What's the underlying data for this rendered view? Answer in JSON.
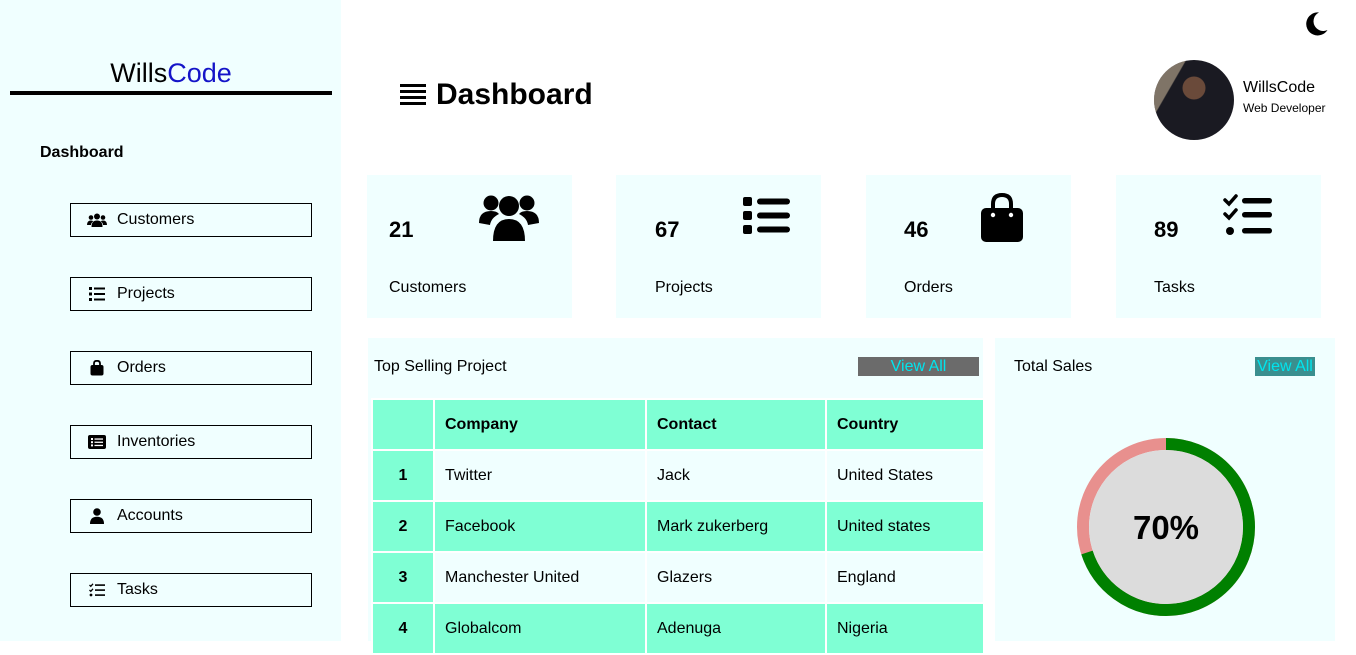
{
  "sidebar": {
    "brand_part1": "Wills",
    "brand_part2": "Code",
    "section_title": "Dashboard",
    "items": [
      {
        "label": "Customers",
        "icon": "users-icon"
      },
      {
        "label": "Projects",
        "icon": "list-icon"
      },
      {
        "label": "Orders",
        "icon": "shopping-bag-icon"
      },
      {
        "label": "Inventories",
        "icon": "list-alt-icon"
      },
      {
        "label": "Accounts",
        "icon": "user-icon"
      },
      {
        "label": "Tasks",
        "icon": "tasks-icon"
      }
    ]
  },
  "header": {
    "title": "Dashboard",
    "theme_toggle_icon": "moon-icon",
    "menu_icon": "hamburger-menu-icon"
  },
  "profile": {
    "name": "WillsCode",
    "role": "Web Developer"
  },
  "stats": [
    {
      "value": "21",
      "label": "Customers",
      "icon": "users-icon"
    },
    {
      "value": "67",
      "label": "Projects",
      "icon": "list-icon"
    },
    {
      "value": "46",
      "label": "Orders",
      "icon": "shopping-bag-icon"
    },
    {
      "value": "89",
      "label": "Tasks",
      "icon": "tasks-icon"
    }
  ],
  "top_selling": {
    "title": "Top Selling Project",
    "view_all": "View All",
    "columns": [
      "",
      "Company",
      "Contact",
      "Country"
    ],
    "rows": [
      {
        "index": "1",
        "company": "Twitter",
        "contact": "Jack",
        "country": "United States"
      },
      {
        "index": "2",
        "company": "Facebook",
        "contact": "Mark zukerberg",
        "country": "United states"
      },
      {
        "index": "3",
        "company": "Manchester United",
        "contact": "Glazers",
        "country": "England"
      },
      {
        "index": "4",
        "company": "Globalcom",
        "contact": "Adenuga",
        "country": "Nigeria"
      }
    ]
  },
  "total_sales": {
    "title": "Total Sales",
    "view_all": "View All",
    "percent_label": "70%",
    "percent_value": 0.7
  },
  "colors": {
    "sidebar_bg": "#f0ffff",
    "table_accent": "#7fffd4",
    "brand_accent": "#1414c8",
    "view_all_text": "#00e5ee",
    "view_all_bg_dark": "#6b6b6b",
    "view_all_bg_teal": "#3a8f8f",
    "donut_progress": "#008000",
    "donut_remaining": "#e8908e",
    "donut_center": "#dcdcdc"
  }
}
